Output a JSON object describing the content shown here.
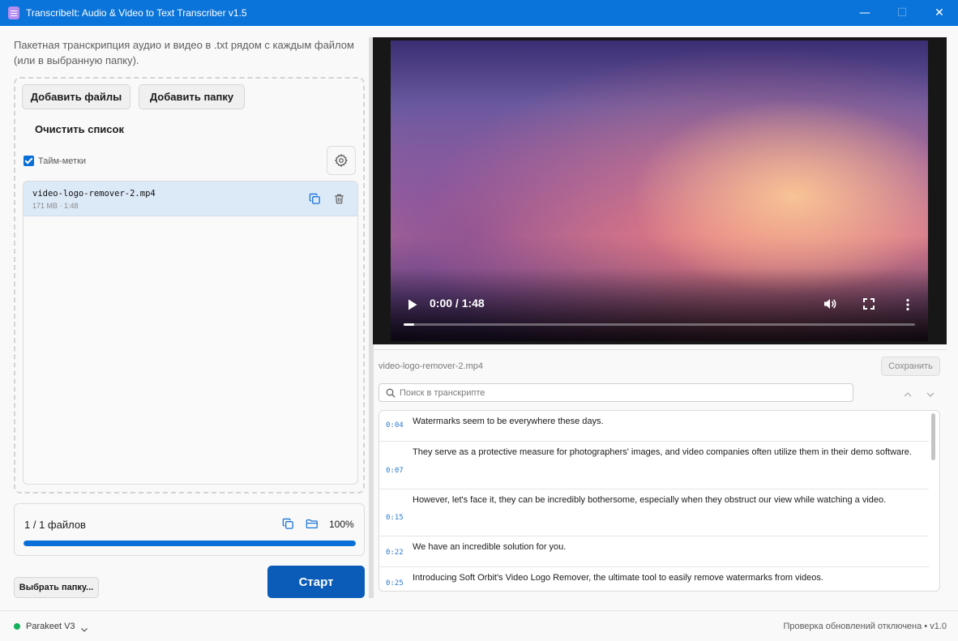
{
  "window": {
    "title": "TranscribeIt: Audio & Video to Text Transcriber v1.5",
    "minimize_glyph": "—",
    "maximize_glyph": "☐",
    "close_glyph": "✕"
  },
  "left_panel": {
    "description": "Пакетная транскрипция аудио и видео в .txt рядом с каждым файлом (или в выбранную папку).",
    "add_files_label": "Добавить файлы",
    "add_folder_label": "Добавить папку",
    "clear_list_label": "Очистить список",
    "timestamps_label": "Тайм-метки",
    "timestamps_checked": true,
    "files": [
      {
        "name": "video-logo-remover-2.mp4",
        "meta": "171 MB · 1:48"
      }
    ],
    "progress": {
      "text": "1 / 1 файлов",
      "percent_label": "100%",
      "fraction": 1.0
    },
    "choose_folder_label": "Выбрать папку...",
    "start_label": "Старт"
  },
  "video": {
    "time": "0:00 / 1:48",
    "played_fraction": 0.02
  },
  "transcript": {
    "file_name": "video-logo-remover-2.mp4",
    "save_label": "Сохранить",
    "search_placeholder": "Поиск в транскрипте",
    "segments": [
      {
        "time": "0:04",
        "text": "Watermarks seem to be everywhere these days."
      },
      {
        "time": "0:07",
        "text": "They serve as a protective measure for photographers' images, and video companies often utilize them in their demo software."
      },
      {
        "time": "0:15",
        "text": "However, let's face it, they can be incredibly bothersome, especially when they obstruct our view while watching a video."
      },
      {
        "time": "0:22",
        "text": "We have an incredible solution for you."
      },
      {
        "time": "0:25",
        "text": "Introducing Soft Orbit's Video Logo Remover, the ultimate tool to easily remove watermarks from videos."
      }
    ]
  },
  "statusbar": {
    "model": "Parakeet V3",
    "status_dot_color": "#18b15a",
    "right_text": "Проверка обновлений отключена • v1.0"
  },
  "colors": {
    "accent": "#0a74da",
    "start_button": "#0b5cb8",
    "timestamp": "#2a7bd0"
  }
}
